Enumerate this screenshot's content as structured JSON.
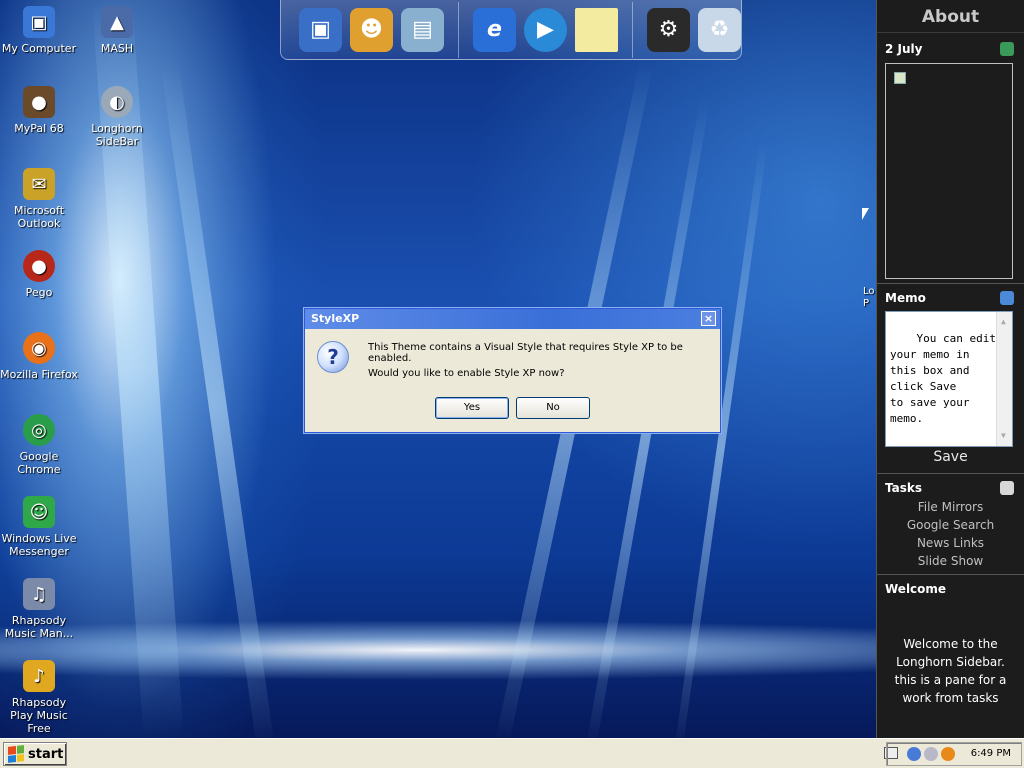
{
  "desktop_icons": [
    {
      "label": "My Computer",
      "icon": "my-computer-icon",
      "color": "#3a78d8"
    },
    {
      "label": "MASH",
      "icon": "mash-icon",
      "color": "#4a6aa8"
    },
    {
      "label": "MyPal 68",
      "icon": "mypal-icon",
      "color": "#6b4a2a"
    },
    {
      "label": "Longhorn SideBar",
      "icon": "longhorn-sidebar-icon",
      "color": "#9aa8b8"
    },
    {
      "label": "Microsoft Outlook",
      "icon": "outlook-icon",
      "color": "#c9a227"
    },
    {
      "label": "Pego",
      "icon": "pego-icon",
      "color": "#b8281a"
    },
    {
      "label": "Mozilla Firefox",
      "icon": "firefox-icon",
      "color": "#e8711a"
    },
    {
      "label": "Google Chrome",
      "icon": "chrome-icon",
      "color": "#2a9d4a"
    },
    {
      "label": "Windows Live Messenger",
      "icon": "messenger-icon",
      "color": "#2fa84a"
    },
    {
      "label": "Rhapsody Music Man...",
      "icon": "rhapsody-manager-icon",
      "color": "#7a8aa8"
    },
    {
      "label": "Rhapsody Play Music Free",
      "icon": "rhapsody-play-icon",
      "color": "#e0a820"
    }
  ],
  "dock": {
    "items": [
      {
        "icon": "computer-icon",
        "color": "#3a6fc8"
      },
      {
        "icon": "users-icon",
        "color": "#e0a030"
      },
      {
        "icon": "scanner-icon",
        "color": "#8ab0d0"
      },
      {
        "icon": "internet-explorer-icon",
        "color": "#2a6fd8"
      },
      {
        "icon": "media-player-icon",
        "color": "#2a8ad8"
      },
      {
        "icon": "notes-icon",
        "color": "#f3eba0"
      },
      {
        "icon": "settings-icon",
        "color": "#2a2a2a"
      },
      {
        "icon": "recycle-bin-icon",
        "color": "#c8d8e8"
      }
    ]
  },
  "dialog": {
    "title": "StyleXP",
    "close_label": "×",
    "icon_glyph": "?",
    "message_line1": "This Theme contains a Visual Style that requires Style XP to be enabled.",
    "message_line2": "Would you like to enable Style XP now?",
    "yes_label": "Yes",
    "no_label": "No"
  },
  "desktop_edge_text": "Lo\nP",
  "sidebar": {
    "header": "About",
    "calendar": {
      "title": "2 July"
    },
    "memo": {
      "title": "Memo",
      "text": "You can edit\nyour memo in\nthis box and\nclick Save\nto save your\nmemo.",
      "save_label": "Save"
    },
    "tasks": {
      "title": "Tasks",
      "items": [
        "File Mirrors",
        "Google Search",
        "News Links",
        "Slide Show"
      ]
    },
    "welcome": {
      "title": "Welcome",
      "text": "Welcome to the Longhorn Sidebar. this is a pane for a work from tasks"
    }
  },
  "taskbar": {
    "start_label": "start",
    "clock": "6:49 PM",
    "colors": {
      "taskbar_bg": "#ece9d8",
      "sidebar_bg": "#1c1c1c"
    }
  }
}
